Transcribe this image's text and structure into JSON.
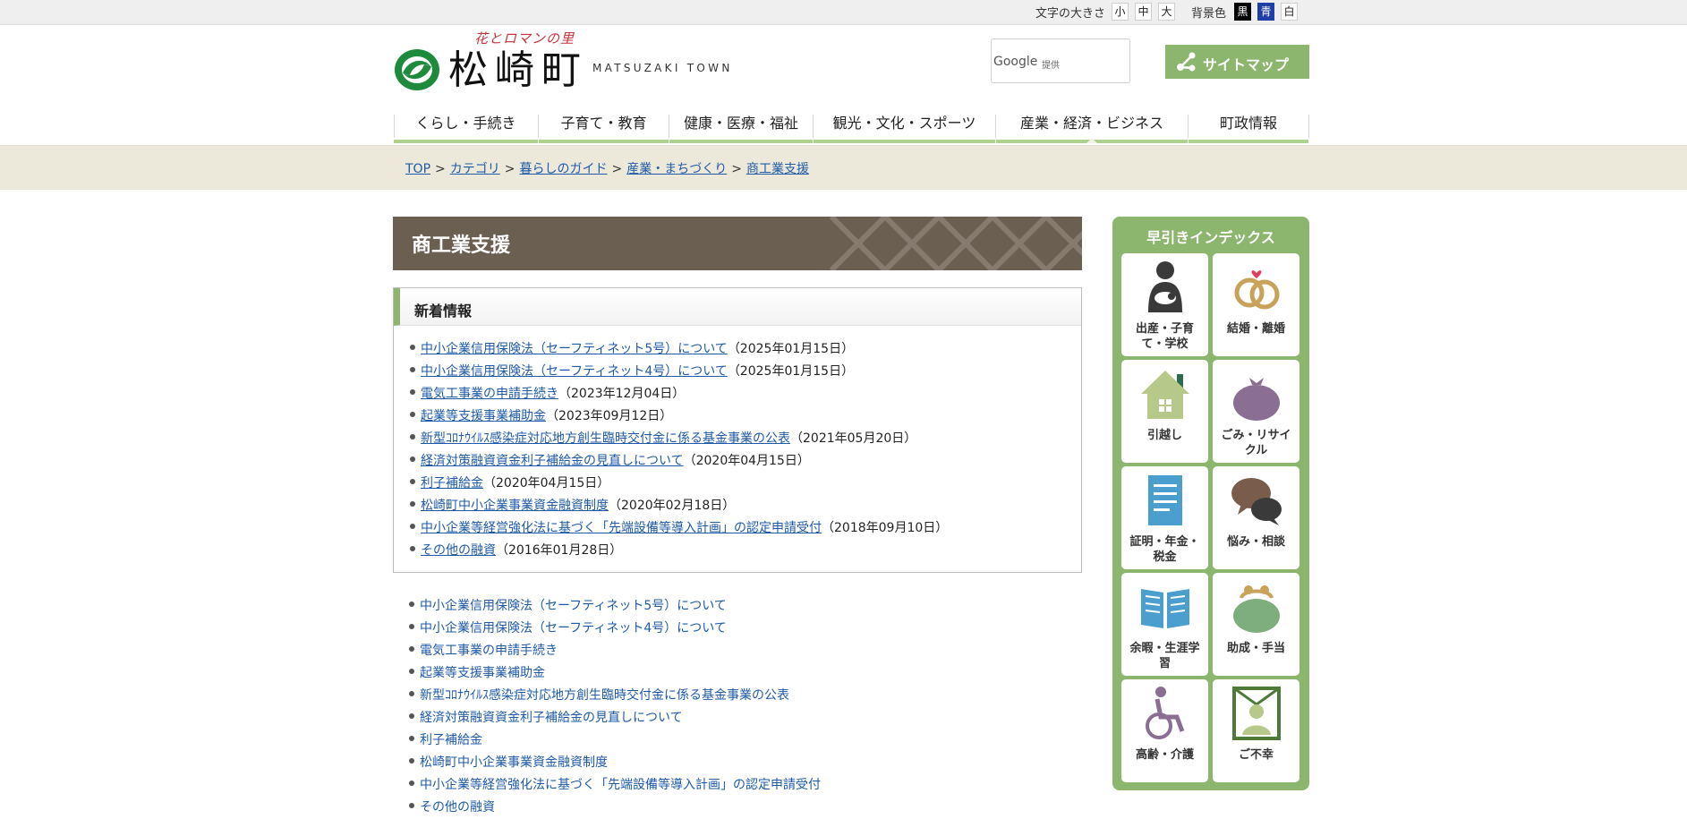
{
  "utility": {
    "font_size_label": "文字の大きさ",
    "font_sizes": [
      "小",
      "中",
      "大"
    ],
    "bg_label": "背景色",
    "bg_options": [
      "黒",
      "青",
      "白"
    ]
  },
  "header": {
    "logo_tagline": "花とロマンの里",
    "logo_name": "松崎町",
    "logo_en": "MATSUZAKI TOWN",
    "search_brand": "Google",
    "search_provided": "提供",
    "sitemap_label": "サイトマップ"
  },
  "nav": {
    "items": [
      "くらし・手続き",
      "子育て・教育",
      "健康・医療・福祉",
      "観光・文化・スポーツ",
      "産業・経済・ビジネス",
      "町政情報"
    ]
  },
  "breadcrumb": [
    "TOP",
    "カテゴリ",
    "暮らしのガイド",
    "産業・まちづくり",
    "商工業支援"
  ],
  "breadcrumb_sep": ">",
  "page_title": "商工業支援",
  "news": {
    "heading": "新着情報",
    "items": [
      {
        "title": "中小企業信用保険法（セーフティネット5号）について",
        "date": "（2025年01月15日）"
      },
      {
        "title": "中小企業信用保険法（セーフティネット4号）について",
        "date": "（2025年01月15日）"
      },
      {
        "title": "電気工事業の申請手続き",
        "date": "（2023年12月04日）"
      },
      {
        "title": "起業等支援事業補助金",
        "date": "（2023年09月12日）"
      },
      {
        "title": "新型ｺﾛﾅｳｲﾙｽ感染症対応地方創生臨時交付金に係る基金事業の公表",
        "date": "（2021年05月20日）"
      },
      {
        "title": "経済対策融資資金利子補給金の見直しについて",
        "date": "（2020年04月15日）"
      },
      {
        "title": "利子補給金",
        "date": "（2020年04月15日）"
      },
      {
        "title": "松崎町中小企業事業資金融資制度",
        "date": "（2020年02月18日）"
      },
      {
        "title": "中小企業等経営強化法に基づく「先端設備等導入計画」の認定申請受付",
        "date": "（2018年09月10日）"
      },
      {
        "title": "その他の融資",
        "date": "（2016年01月28日）"
      }
    ]
  },
  "list": [
    "中小企業信用保険法（セーフティネット5号）について",
    "中小企業信用保険法（セーフティネット4号）について",
    "電気工事業の申請手続き",
    "起業等支援事業補助金",
    "新型ｺﾛﾅｳｲﾙｽ感染症対応地方創生臨時交付金に係る基金事業の公表",
    "経済対策融資資金利子補給金の見直しについて",
    "利子補給金",
    "松崎町中小企業事業資金融資制度",
    "中小企業等経営強化法に基づく「先端設備等導入計画」の認定申請受付",
    "その他の融資"
  ],
  "index": {
    "title": "早引きインデックス",
    "tiles": [
      {
        "label": "出産・子育て・学校",
        "icon": "mother-child-icon"
      },
      {
        "label": "結婚・離婚",
        "icon": "rings-icon"
      },
      {
        "label": "引越し",
        "icon": "house-icon"
      },
      {
        "label": "ごみ・リサイクル",
        "icon": "garbage-bag-icon"
      },
      {
        "label": "証明・年金・税金",
        "icon": "document-icon"
      },
      {
        "label": "悩み・相談",
        "icon": "speech-bubbles-icon"
      },
      {
        "label": "余暇・生涯学習",
        "icon": "open-book-icon"
      },
      {
        "label": "助成・手当",
        "icon": "coin-purse-icon"
      },
      {
        "label": "高齢・介護",
        "icon": "wheelchair-icon"
      },
      {
        "label": "ご不幸",
        "icon": "memorial-portrait-icon"
      }
    ]
  },
  "colors": {
    "accent_green": "#8cb56e",
    "title_bar_brown": "#6b5f52",
    "link_blue": "#1e5aa8",
    "breadcrumb_band": "#ece9da"
  }
}
